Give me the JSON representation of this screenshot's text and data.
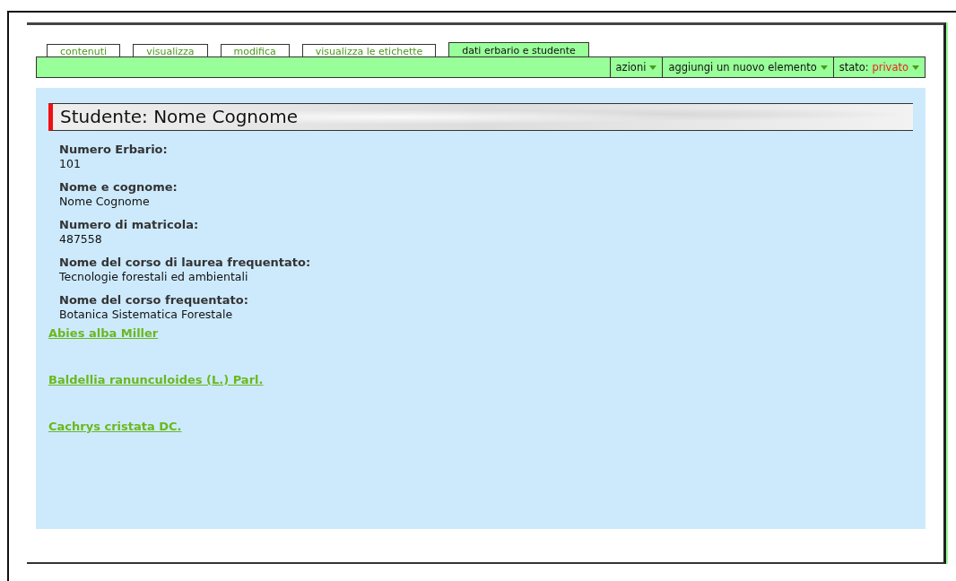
{
  "tabs": [
    {
      "label": "contenuti",
      "selected": false
    },
    {
      "label": "visualizza",
      "selected": false
    },
    {
      "label": "modifica",
      "selected": false
    },
    {
      "label": "visualizza le etichette",
      "selected": false
    },
    {
      "label": "dati erbario e studente",
      "selected": true
    }
  ],
  "actions": [
    {
      "label": "azioni"
    },
    {
      "label": "aggiungi un nuovo elemento"
    },
    {
      "label": "stato:",
      "value": "privato"
    }
  ],
  "heading": "Studente: Nome Cognome",
  "fields": [
    {
      "label": "Numero Erbario:",
      "value": "101"
    },
    {
      "label": "Nome e cognome:",
      "value": "Nome Cognome"
    },
    {
      "label": "Numero di matricola:",
      "value": "487558"
    },
    {
      "label": "Nome del corso di laurea frequentato:",
      "value": "Tecnologie forestali ed ambientali"
    },
    {
      "label": "Nome del corso frequentato:",
      "value": "Botanica Sistematica Forestale"
    }
  ],
  "links": [
    "Abies alba Miller",
    "Baldellia ranunculoides (L.) Parl.",
    "Cachrys cristata DC."
  ]
}
